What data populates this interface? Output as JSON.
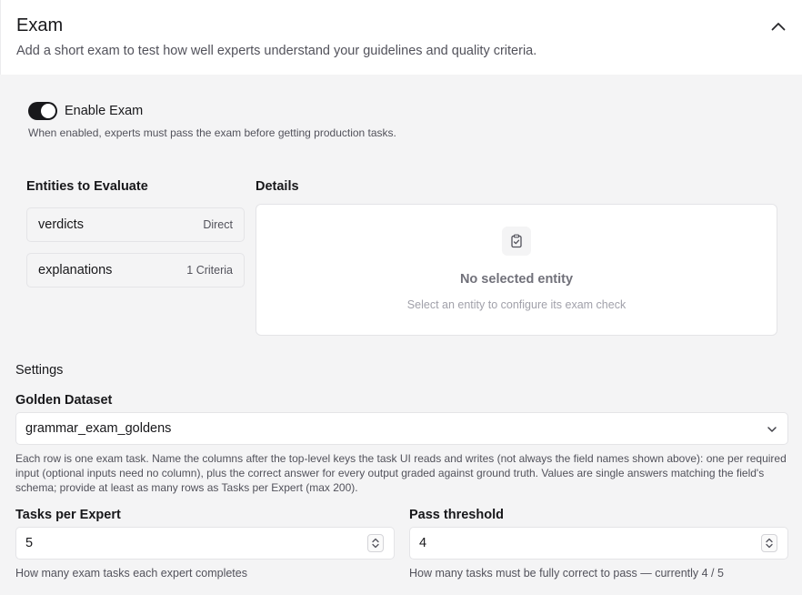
{
  "header": {
    "title": "Exam",
    "subtitle": "Add a short exam to test how well experts understand your guidelines and quality criteria."
  },
  "enable_exam": {
    "label": "Enable Exam",
    "enabled": true,
    "help": "When enabled, experts must pass the exam before getting production tasks."
  },
  "entities": {
    "heading": "Entities to Evaluate",
    "items": [
      {
        "name": "verdicts",
        "tag": "Direct"
      },
      {
        "name": "explanations",
        "tag": "1 Criteria"
      }
    ]
  },
  "details": {
    "heading": "Details",
    "empty_title": "No selected entity",
    "empty_help": "Select an entity to configure its exam check"
  },
  "settings": {
    "heading": "Settings",
    "golden_dataset": {
      "label": "Golden Dataset",
      "value": "grammar_exam_goldens",
      "help": "Each row is one exam task. Name the columns after the top-level keys the task UI reads and writes (not always the field names shown above): one per required input (optional inputs need no column), plus the correct answer for every output graded against ground truth. Values are single answers matching the field's schema; provide at least as many rows as Tasks per Expert (max 200)."
    },
    "tasks_per_expert": {
      "label": "Tasks per Expert",
      "value": "5",
      "help": "How many exam tasks each expert completes"
    },
    "pass_threshold": {
      "label": "Pass threshold",
      "value": "4",
      "help": "How many tasks must be fully correct to pass — currently 4 / 5"
    }
  },
  "icons": {
    "collapse": "chevron-up-icon",
    "details_empty": "clipboard-check-icon",
    "select": "chevron-down-icon",
    "stepper": "up-down-stepper-icon"
  },
  "colors": {
    "toggle_on": "#18181b",
    "page_background": "#f4f4f5"
  }
}
